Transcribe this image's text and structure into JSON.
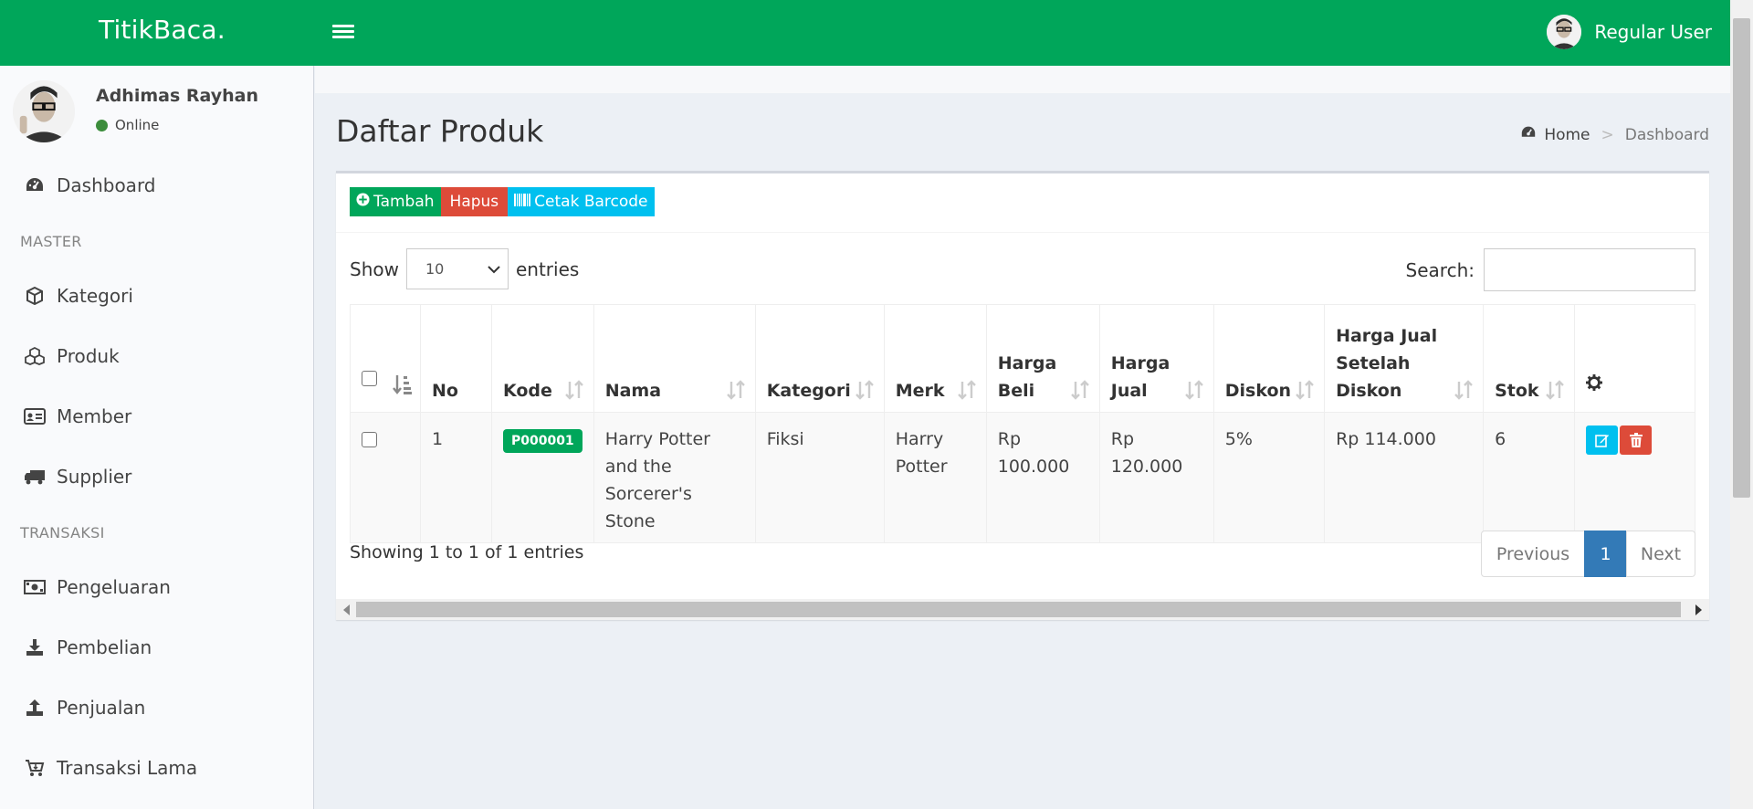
{
  "header": {
    "brand": "TitikBaca.",
    "user_name": "Regular User"
  },
  "sidebar": {
    "profile_name": "Adhimas Rayhan",
    "profile_status": "Online",
    "items": [
      {
        "label": "Dashboard",
        "icon": "dashboard-icon"
      },
      {
        "label": "Kategori",
        "icon": "cube-icon"
      },
      {
        "label": "Produk",
        "icon": "cubes-icon"
      },
      {
        "label": "Member",
        "icon": "id-card-icon"
      },
      {
        "label": "Supplier",
        "icon": "truck-icon"
      },
      {
        "label": "Pengeluaran",
        "icon": "money-icon"
      },
      {
        "label": "Pembelian",
        "icon": "download-icon"
      },
      {
        "label": "Penjualan",
        "icon": "upload-icon"
      },
      {
        "label": "Transaksi Lama",
        "icon": "cart-icon"
      }
    ],
    "headers": [
      "MASTER",
      "TRANSAKSI"
    ]
  },
  "page": {
    "title": "Daftar Produk",
    "breadcrumb_home": "Home",
    "breadcrumb_separator": ">",
    "breadcrumb_current": "Dashboard"
  },
  "toolbar": {
    "add_label": "Tambah",
    "delete_label": "Hapus",
    "barcode_label": "Cetak Barcode"
  },
  "datatable": {
    "show_label": "Show",
    "entries_label": "entries",
    "page_length": "10",
    "search_label": "Search:",
    "search_value": "",
    "columns": [
      "No",
      "Kode",
      "Nama",
      "Kategori",
      "Merk",
      "Harga Beli",
      "Harga Jual",
      "Diskon",
      "Harga Jual Setelah Diskon",
      "Stok"
    ],
    "rows": [
      {
        "no": "1",
        "kode": "P000001",
        "nama": "Harry Potter and the Sorcerer's Stone",
        "kategori": "Fiksi",
        "merk": "Harry Potter",
        "harga_beli": "Rp 100.000",
        "harga_jual": "Rp 120.000",
        "diskon": "5%",
        "harga_setelah_diskon": "Rp 114.000",
        "stok": "6"
      }
    ],
    "info": "Showing 1 to 1 of 1 entries",
    "pagination": {
      "previous": "Previous",
      "current": "1",
      "next": "Next"
    }
  },
  "colors": {
    "header_green": "#00a65a",
    "danger_red": "#dd4b39",
    "info_cyan": "#00c0ef",
    "primary_blue": "#337ab7"
  }
}
